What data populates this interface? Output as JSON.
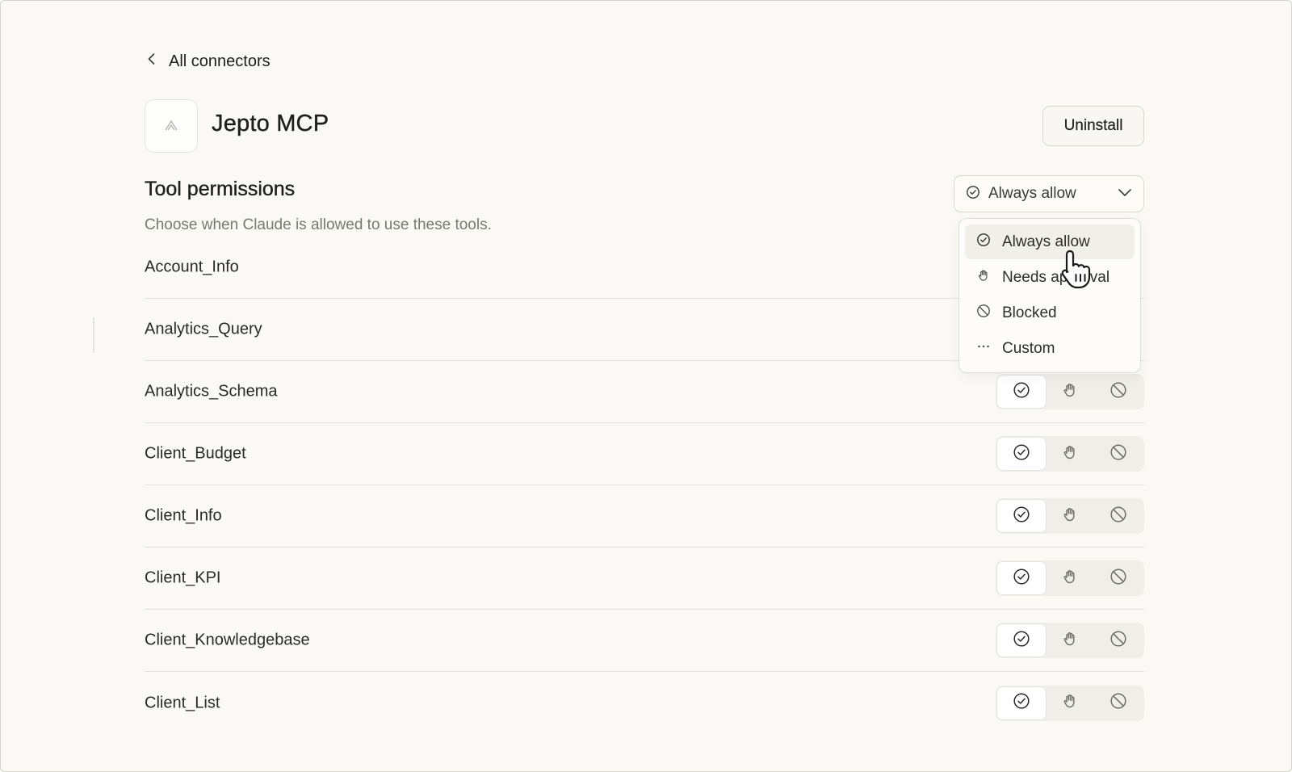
{
  "nav": {
    "back_label": "All connectors"
  },
  "connector": {
    "name": "Jepto MCP",
    "uninstall_label": "Uninstall"
  },
  "permissions": {
    "title": "Tool permissions",
    "description": "Choose when Claude is allowed to use these tools.",
    "global_select": {
      "value": "Always allow",
      "icon": "check-circle-icon"
    }
  },
  "dropdown": {
    "options": [
      {
        "label": "Always allow",
        "icon": "check-circle-icon",
        "selected": true
      },
      {
        "label": "Needs approval",
        "icon": "hand-icon",
        "selected": false
      },
      {
        "label": "Blocked",
        "icon": "blocked-icon",
        "selected": false
      },
      {
        "label": "Custom",
        "icon": "more-horizontal-icon",
        "selected": false
      }
    ]
  },
  "tools": [
    {
      "name": "Account_Info",
      "permission": "always"
    },
    {
      "name": "Analytics_Query",
      "permission": "always"
    },
    {
      "name": "Analytics_Schema",
      "permission": "always"
    },
    {
      "name": "Client_Budget",
      "permission": "always"
    },
    {
      "name": "Client_Info",
      "permission": "always"
    },
    {
      "name": "Client_KPI",
      "permission": "always"
    },
    {
      "name": "Client_Knowledgebase",
      "permission": "always"
    },
    {
      "name": "Client_List",
      "permission": "always"
    }
  ],
  "colors": {
    "background": "#faf9f5",
    "text": "#1f1e1d",
    "muted": "#7a7872",
    "segment_bg": "#efeee9"
  }
}
